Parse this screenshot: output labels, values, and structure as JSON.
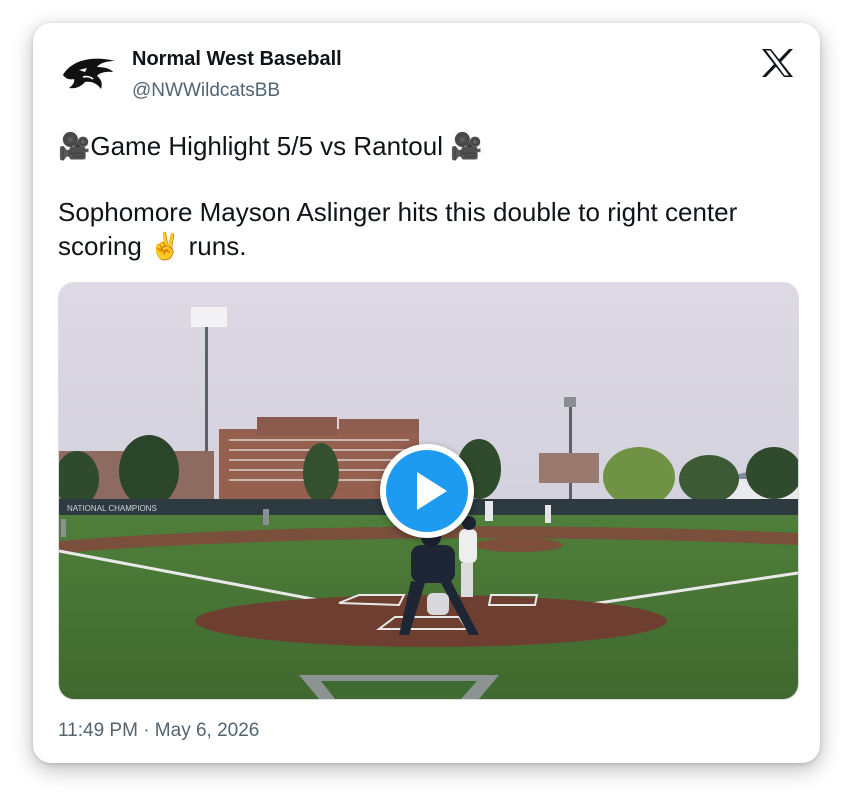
{
  "account": {
    "display_name": "Normal West Baseball",
    "handle": "@NWWildcatsBB",
    "avatar_icon": "wildcat-logo"
  },
  "platform_icon": "x-logo-icon",
  "tweet": {
    "line1": "🎥Game Highlight 5/5 vs Rantoul 🎥",
    "line2": "Sophomore Mayson Aslinger hits this double to right center scoring ✌️ runs."
  },
  "media": {
    "type": "video",
    "play_icon": "play-icon",
    "accent_color": "#1d9bf0",
    "outfield_banner": "NATIONAL CHAMPIONS"
  },
  "timestamp": "11:49 PM · May 6, 2026"
}
